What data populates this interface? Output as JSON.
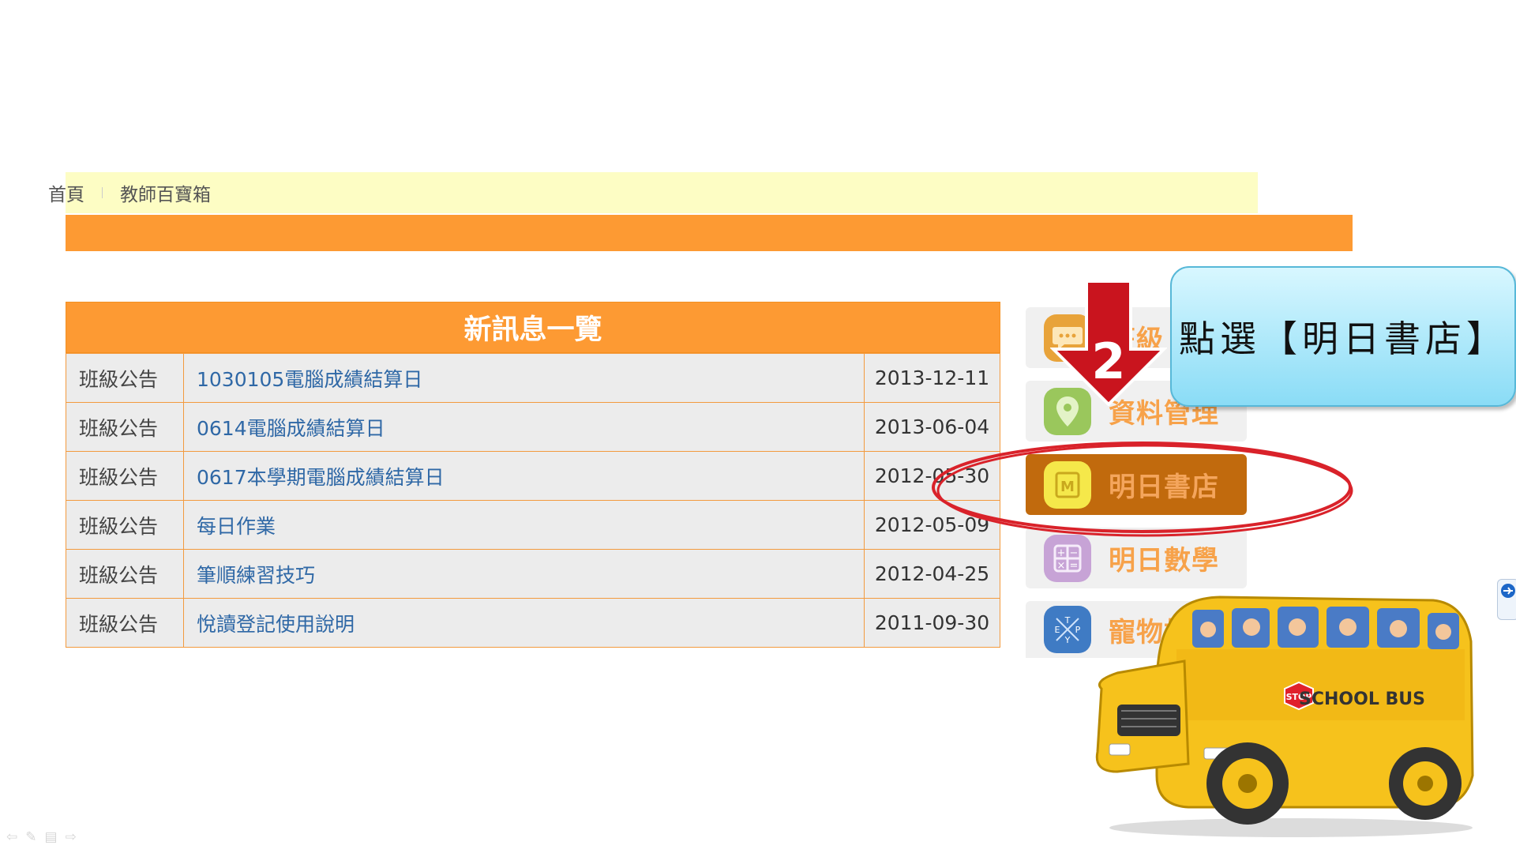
{
  "nav": {
    "items": [
      "首頁",
      "教師百寶箱"
    ]
  },
  "news": {
    "title": "新訊息一覽",
    "rows": [
      {
        "category": "班級公告",
        "title": "1030105電腦成績結算日",
        "date": "2013-12-11"
      },
      {
        "category": "班級公告",
        "title": "0614電腦成績結算日",
        "date": "2013-06-04"
      },
      {
        "category": "班級公告",
        "title": "0617本學期電腦成績結算日",
        "date": "2012-05-30"
      },
      {
        "category": "班級公告",
        "title": "每日作業",
        "date": "2012-05-09"
      },
      {
        "category": "班級公告",
        "title": "筆順練習技巧",
        "date": "2012-04-25"
      },
      {
        "category": "班級公告",
        "title": "悅讀登記使用說明",
        "date": "2011-09-30"
      }
    ]
  },
  "menu": {
    "items": [
      {
        "label": "班級",
        "icon": "chat-icon",
        "color": "#e8a33a"
      },
      {
        "label": "資料管理",
        "icon": "location-pin-icon",
        "color": "#9ac75c"
      },
      {
        "label": "明日書店",
        "icon": "book-icon",
        "color": "#f5e84a",
        "active": true
      },
      {
        "label": "明日數學",
        "icon": "calculator-icon",
        "color": "#c7a3d6"
      },
      {
        "label": "寵物打字",
        "icon": "typing-icon",
        "color": "#3f7bc4"
      }
    ]
  },
  "annotation": {
    "step_number": "2",
    "callout_text": "點選【明日書店】",
    "highlight_color": "#d9222a"
  },
  "bus": {
    "stop_text": "STOP",
    "label": "SCHOOL BUS"
  }
}
